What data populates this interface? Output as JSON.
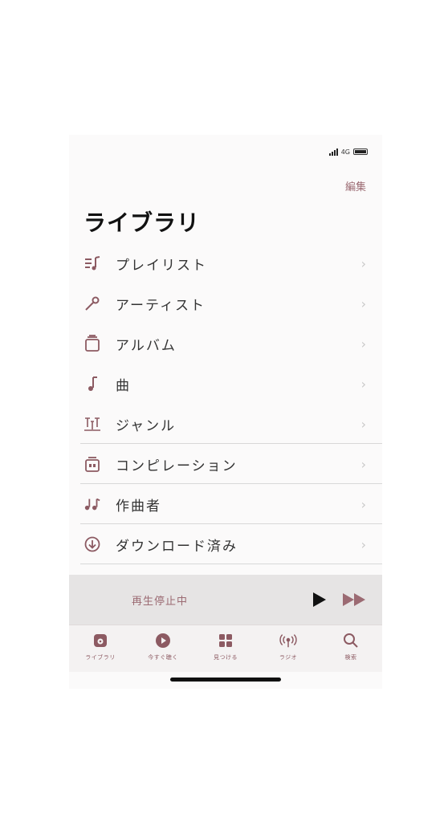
{
  "status": {
    "network": "4G"
  },
  "header": {
    "edit_label": "編集",
    "title": "ライブラリ"
  },
  "library_items": [
    {
      "label": "プレイリスト",
      "icon": "playlist-icon"
    },
    {
      "label": "アーティスト",
      "icon": "microphone-icon"
    },
    {
      "label": "アルバム",
      "icon": "album-icon"
    },
    {
      "label": "曲",
      "icon": "music-note-icon"
    },
    {
      "label": "ジャンル",
      "icon": "genre-icon"
    },
    {
      "label": "コンピレーション",
      "icon": "compilation-icon"
    },
    {
      "label": "作曲者",
      "icon": "composer-icon"
    },
    {
      "label": "ダウンロード済み",
      "icon": "download-icon"
    }
  ],
  "player": {
    "status_text": "再生停止中"
  },
  "tabs": [
    {
      "label": "ライブラリ",
      "icon": "library-icon"
    },
    {
      "label": "今すぐ聴く",
      "icon": "listen-now-icon"
    },
    {
      "label": "見つける",
      "icon": "browse-icon"
    },
    {
      "label": "ラジオ",
      "icon": "radio-icon"
    },
    {
      "label": "検索",
      "icon": "search-icon"
    }
  ],
  "colors": {
    "accent": "#8c5a62",
    "player_bg": "#e6e4e4",
    "separator": "#d8d8d8"
  }
}
